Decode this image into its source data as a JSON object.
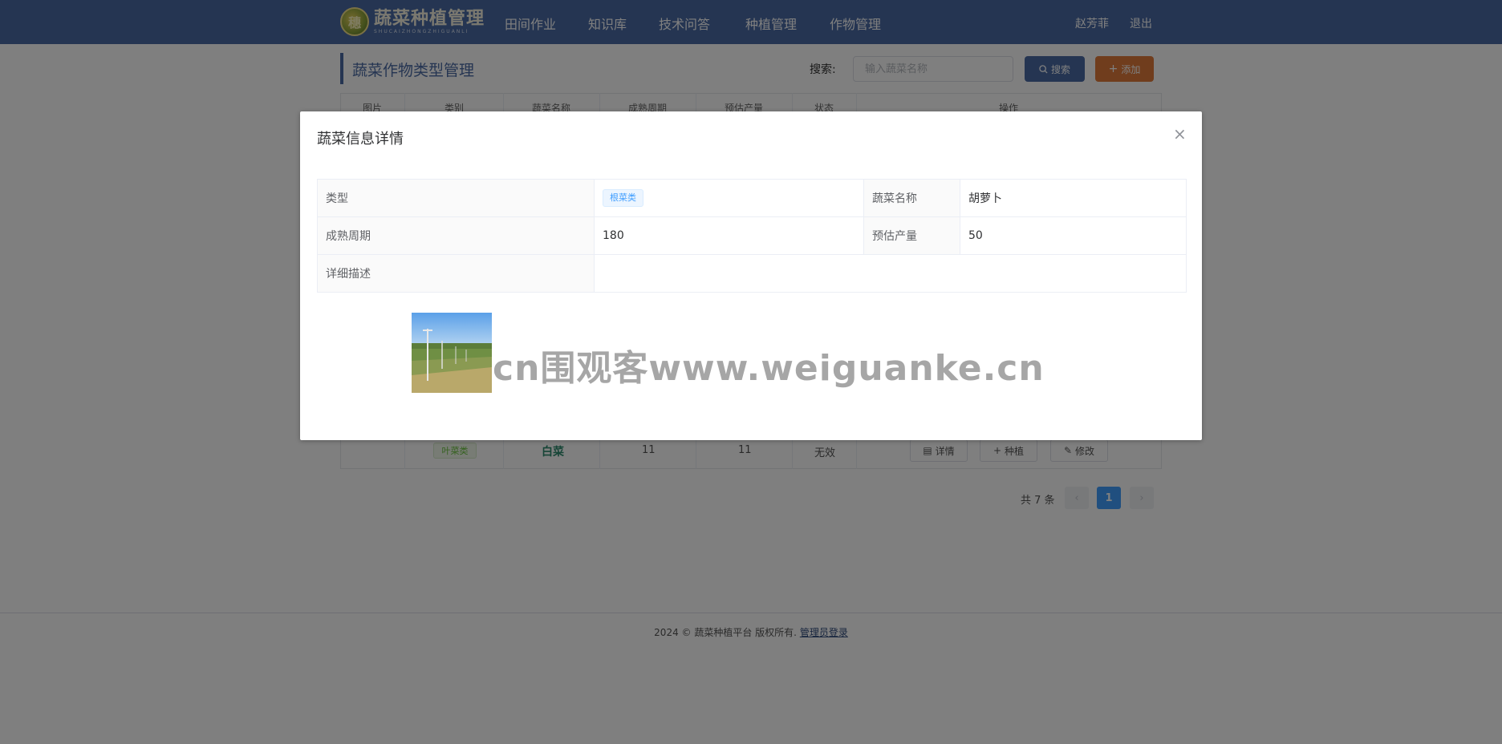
{
  "header": {
    "logo_title": "蔬菜种植管理",
    "logo_sub": "SHUCAIZHONGZHIGUANLI",
    "nav": [
      "田间作业",
      "知识库",
      "技术问答",
      "种植管理",
      "作物管理"
    ],
    "user_name": "赵芳菲",
    "logout": "退出"
  },
  "page": {
    "title": "蔬菜作物类型管理",
    "search_label": "搜索:",
    "search_placeholder": "输入蔬菜名称",
    "search_button": "搜索",
    "add_button": "添加"
  },
  "table": {
    "columns": [
      "图片",
      "类别",
      "蔬菜名称",
      "成熟周期",
      "预估产量",
      "状态",
      "操作"
    ],
    "last_row": {
      "category": "叶菜类",
      "name": "白菜",
      "cycle": "11",
      "yield": "11",
      "status": "无效",
      "actions": [
        "详情",
        "种植",
        "修改"
      ]
    }
  },
  "pagination": {
    "total": "共 7 条",
    "current": "1",
    "prev": "‹",
    "next": "›"
  },
  "footer": {
    "text": "2024 © 蔬菜种植平台 版权所有.",
    "admin_link": "管理员登录"
  },
  "dialog": {
    "title": "蔬菜信息详情",
    "close": "×",
    "labels": {
      "type": "类型",
      "name": "蔬菜名称",
      "cycle": "成熟周期",
      "yield": "预估产量",
      "desc": "详细描述"
    },
    "values": {
      "type": "根菜类",
      "name": "胡萝卜",
      "cycle": "180",
      "yield": "50",
      "desc": ""
    }
  },
  "watermark": "cn围观客www.weiguanke.cn",
  "colors": {
    "header": "#4a6aa5",
    "add": "#e07b3a",
    "accent_blue": "#409eff",
    "green": "#67c23a"
  }
}
